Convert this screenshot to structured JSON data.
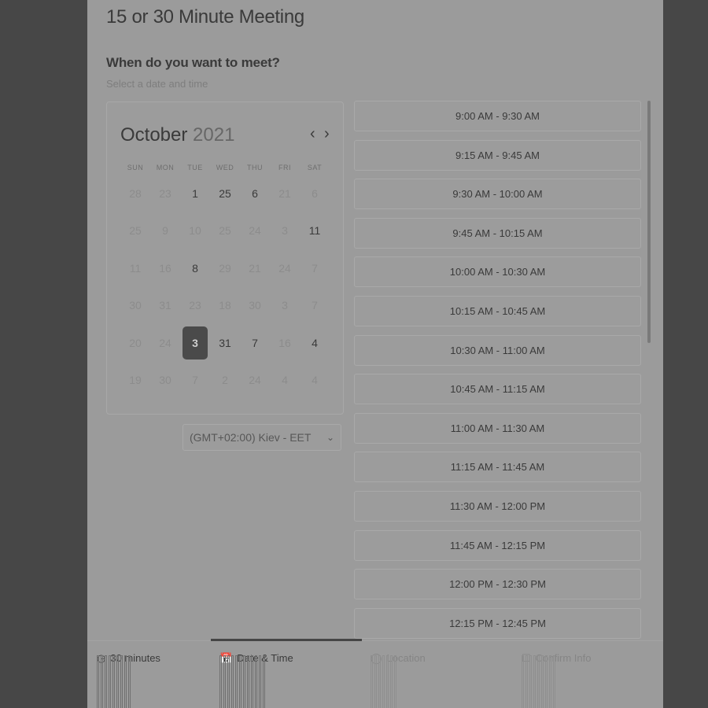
{
  "panel": {
    "title": "15 or 30 Minute Meeting",
    "question": "When do you want to meet?",
    "hint": "Select a date and time"
  },
  "calendar": {
    "month": "October",
    "year": "2021",
    "weekdays": [
      "SUN",
      "MON",
      "TUE",
      "WED",
      "THU",
      "FRI",
      "SAT"
    ],
    "weeks": [
      [
        "28",
        "23",
        "1",
        "25",
        "6",
        "21",
        "6"
      ],
      [
        "25",
        "9",
        "10",
        "25",
        "24",
        "3",
        "11"
      ],
      [
        "11",
        "16",
        "8",
        "29",
        "21",
        "24",
        "7"
      ],
      [
        "30",
        "31",
        "23",
        "18",
        "30",
        "3",
        "7"
      ],
      [
        "20",
        "24",
        "3",
        "31",
        "7",
        "16",
        "4"
      ],
      [
        "19",
        "30",
        "7",
        "2",
        "24",
        "4",
        "4"
      ]
    ],
    "selected": "3"
  },
  "timezone": {
    "label": "(GMT+02:00) Kiev - EET"
  },
  "slots": [
    "9:00 AM - 9:30 AM",
    "9:15 AM - 9:45 AM",
    "9:30 AM - 10:00 AM",
    "9:45 AM - 10:15 AM",
    "10:00 AM - 10:30 AM",
    "10:15 AM - 10:45 AM",
    "10:30 AM - 11:00 AM",
    "10:45 AM - 11:15 AM",
    "11:00 AM - 11:30 AM",
    "11:15 AM - 11:45 AM",
    "11:30 AM - 12:00 PM",
    "11:45 AM - 12:15 PM",
    "12:00 PM - 12:30 PM",
    "12:15 PM - 12:45 PM"
  ],
  "steps": [
    {
      "label": "30 minutes",
      "icon": "clock-icon"
    },
    {
      "label": "Date & Time",
      "icon": "calendar-icon"
    },
    {
      "label": "Location",
      "icon": "location-icon"
    },
    {
      "label": "Confirm Info",
      "icon": "confirm-icon"
    }
  ],
  "colors": {
    "overlay": "#474747",
    "panel": "#9b9b9b",
    "selected_day": "#4a4a4a"
  }
}
